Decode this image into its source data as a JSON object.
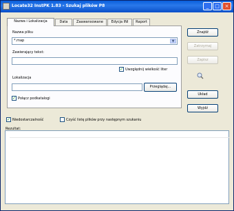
{
  "window": {
    "title": "Locate32 InstPK 1.83 - Szukaj plików P8",
    "minimize": "_",
    "maximize": "□",
    "close": "×"
  },
  "tabs": [
    {
      "label": "Nazwa i Lokalizacja",
      "active": true
    },
    {
      "label": "Data",
      "active": false
    },
    {
      "label": "Zaawansowane",
      "active": false
    },
    {
      "label": "Edycja INI",
      "active": false
    },
    {
      "label": "Raport",
      "active": false
    }
  ],
  "form": {
    "filename_label": "Nazwa pliku",
    "filename_value": "*.map",
    "contains_text_label": "Zawierający tekst:",
    "contains_text_value": "",
    "match_case_label": "Uwzględnij wielkość liter",
    "match_case_checked": true,
    "location_label": "Lokalizacja",
    "location_value": "",
    "browse_button": "Przeglądaj...",
    "join_subfolders_label": "Połącz podkatalogi",
    "join_subfolders_checked": true
  },
  "side_buttons": {
    "find": "Znajdź",
    "stop": "Zatrzymaj",
    "new": "Zapisz",
    "options": "Układ",
    "close": "Wyjdź"
  },
  "bottom": {
    "checkbox1_label": "Niedostarczalność",
    "checkbox1_checked": true,
    "checkbox2_label": "Czyść listę plików przy następnym szukaniu",
    "checkbox2_checked": false,
    "results_label": "Rezultat:"
  },
  "colors": {
    "titlebar": "#0a5fdc",
    "window_bg": "#ece9d8",
    "panel_bg": "#fcfcfe",
    "input_border": "#7f9db9",
    "button_border": "#003c74"
  },
  "icons": {
    "title": "app-window-icon",
    "side": "magnifier-icon"
  }
}
